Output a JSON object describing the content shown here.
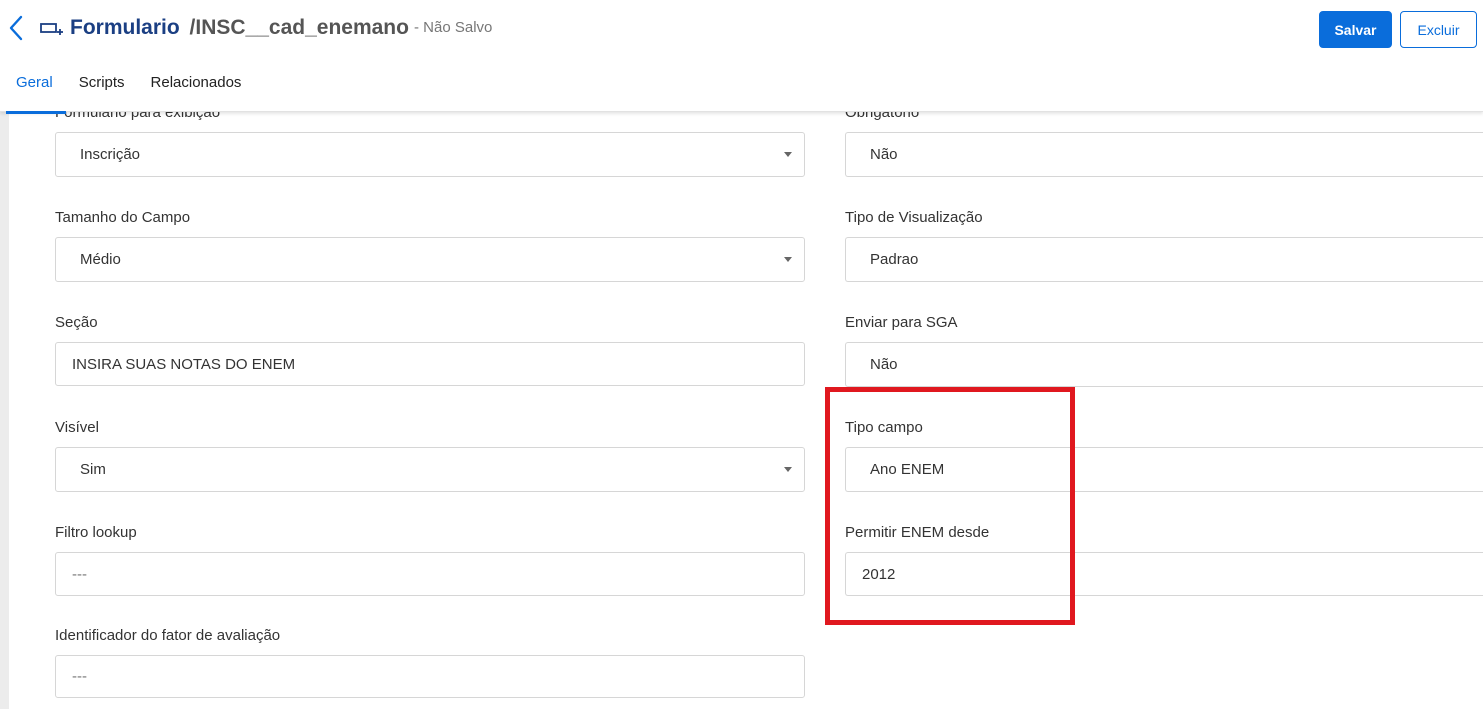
{
  "header": {
    "title": "Formulario",
    "separator": "/",
    "path": "INSC__cad_enemano",
    "status": "- Não Salvo",
    "save_label": "Salvar",
    "delete_label": "Excluir"
  },
  "tabs": [
    {
      "label": "Geral"
    },
    {
      "label": "Scripts"
    },
    {
      "label": "Relacionados"
    }
  ],
  "left_column": {
    "form_display": {
      "label": "Formulario para exibição",
      "value": "Inscrição"
    },
    "field_size": {
      "label": "Tamanho do Campo",
      "value": "Médio"
    },
    "section": {
      "label": "Seção",
      "value": "INSIRA SUAS NOTAS DO ENEM"
    },
    "visible": {
      "label": "Visível",
      "value": "Sim"
    },
    "lookup_filter": {
      "label": "Filtro lookup",
      "value": "---"
    },
    "evaluation_factor": {
      "label": "Identificador do fator de avaliação",
      "value": "---"
    }
  },
  "right_column": {
    "required": {
      "label": "Obrigatorio",
      "value": "Não"
    },
    "view_type": {
      "label": "Tipo de Visualização",
      "value": "Padrao"
    },
    "send_sga": {
      "label": "Enviar para SGA",
      "value": "Não"
    },
    "field_type": {
      "label": "Tipo campo",
      "value": "Ano ENEM"
    },
    "enem_since": {
      "label": "Permitir ENEM desde",
      "value": "2012"
    }
  },
  "colors": {
    "accent": "#0a6ddb",
    "title": "#1b3f83",
    "highlight": "#e0181f"
  },
  "icons": [
    "chevron-left-icon",
    "form-icon",
    "caret-down-icon"
  ]
}
